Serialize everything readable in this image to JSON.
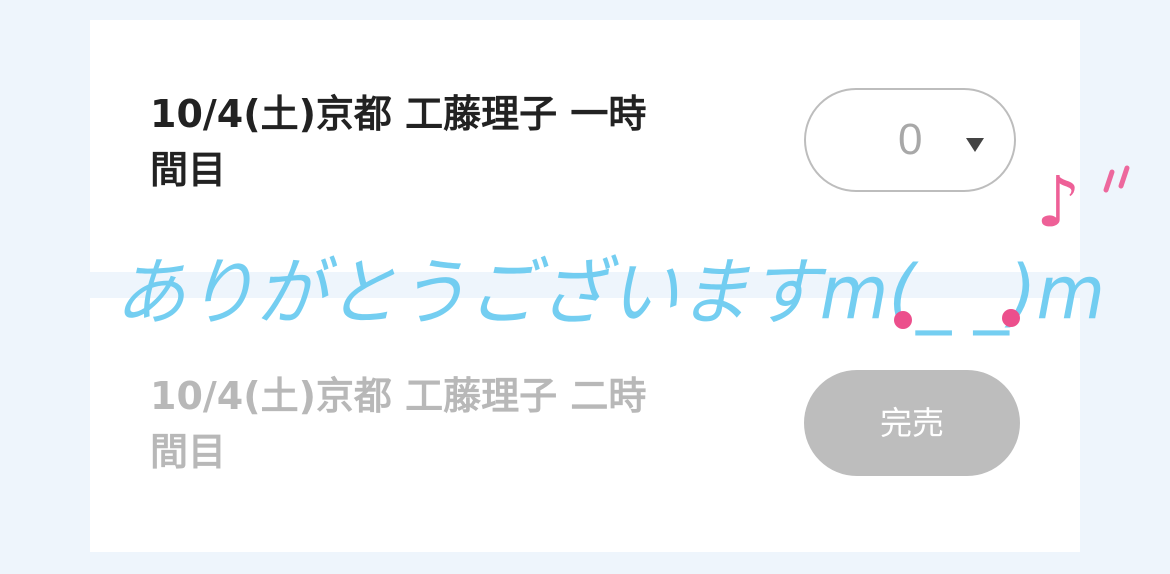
{
  "tickets": [
    {
      "title_line1": "10/4(土)京都 工藤理子 一時",
      "title_line2": "間目",
      "quantity": "0"
    },
    {
      "title_line1": "10/4(土)京都 工藤理子 二時",
      "title_line2": "間目",
      "status": "完売"
    }
  ],
  "handwriting": {
    "message": "ありがとうございますm(_ _)m",
    "note": "♪",
    "colors": {
      "message": "#5cc6ef",
      "accent": "#ec4f8c"
    }
  },
  "colors": {
    "page_bg": "#eef5fc",
    "card_bg": "#ffffff",
    "title_active": "#222222",
    "title_soldout": "#b8b8b8",
    "soldout_bg": "#bdbdbd"
  }
}
